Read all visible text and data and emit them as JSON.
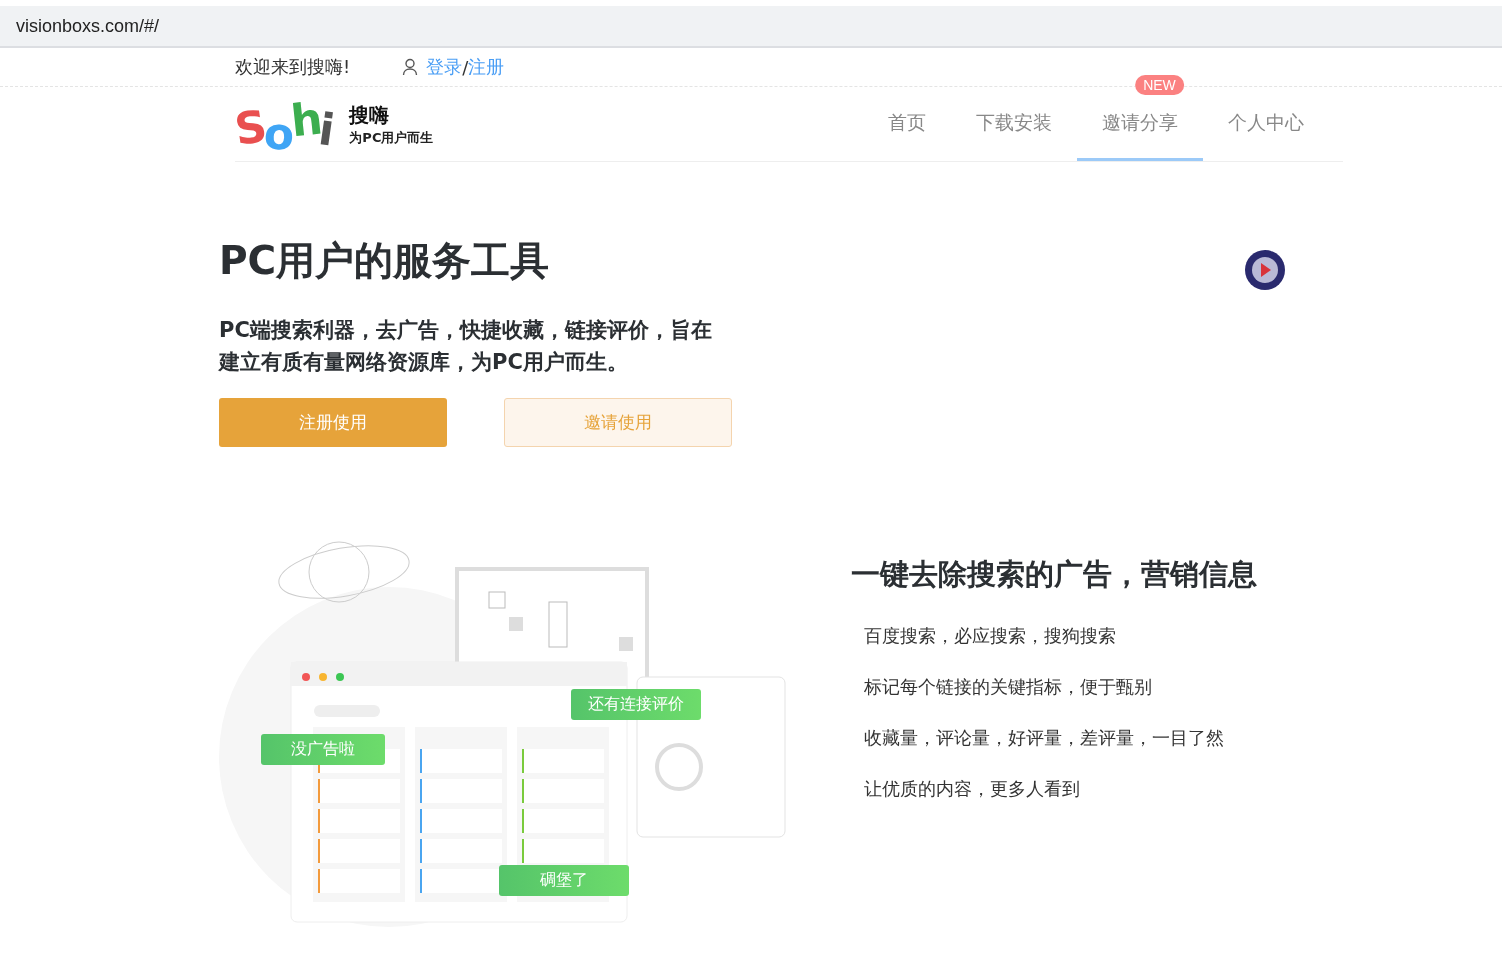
{
  "address_bar": {
    "url": "visionboxs.com/#/"
  },
  "top_bar": {
    "welcome": "欢迎来到搜嗨!",
    "login": "登录",
    "separator": "/",
    "register": "注册"
  },
  "logo": {
    "letters": [
      {
        "char": "S",
        "color": "#e94f4f"
      },
      {
        "char": "o",
        "color": "#3fa5f5"
      },
      {
        "char": "h",
        "color": "#3cae4f"
      },
      {
        "char": "i",
        "color": "#555555"
      }
    ],
    "name": "搜嗨",
    "slogan": "为PC用户而生"
  },
  "nav": [
    {
      "label": "首页",
      "selected": false
    },
    {
      "label": "下载安装",
      "selected": false
    },
    {
      "label": "邀请分享",
      "selected": true,
      "badge": "NEW"
    },
    {
      "label": "个人中心",
      "selected": false
    }
  ],
  "hero": {
    "title": "PC用户的服务工具",
    "subtitle_lines": [
      "PC端搜索利器，去广告，快捷收藏，链接评价，旨在",
      "建立有质有量网络资源库，为PC用户而生。"
    ],
    "primary_button": "注册使用",
    "secondary_button": "邀请使用"
  },
  "illustration": {
    "bubbles": [
      "没广告啦",
      "还有连接评价",
      "碉堡了"
    ]
  },
  "feature": {
    "title": "一键去除搜索的广告，营销信息",
    "points": [
      "百度搜索，必应搜索，搜狗搜索",
      "标记每个链接的关键指标，便于甄别",
      "收藏量，评论量，好评量，差评量，一目了然",
      "让优质的内容，更多人看到"
    ]
  }
}
